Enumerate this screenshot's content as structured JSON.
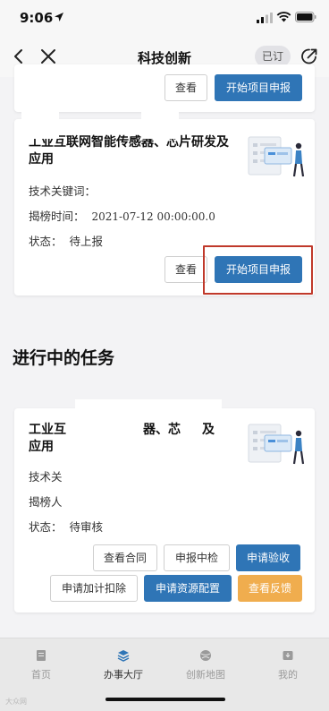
{
  "status_bar": {
    "time": "9:06"
  },
  "nav": {
    "title": "科技创新",
    "subscribe_label": "已订"
  },
  "top_card": {
    "view_label": "查看",
    "apply_label": "开始项目申报"
  },
  "card1": {
    "title": "工业互联网智能传感器、芯片研发及应用",
    "keywords_label": "技术关键词：",
    "time_label": "揭榜时间：",
    "time_value": "2021-07-12 00:00:00.0",
    "status_label": "状态：",
    "status_value": "待上报",
    "view_label": "查看",
    "apply_label": "开始项目申报"
  },
  "section": {
    "in_progress_title": "进行中的任务"
  },
  "card2": {
    "title_line1_start": "工业互",
    "title_line1_end": "器、芯",
    "title_line1_tail": "及",
    "title_line2": "应用",
    "keywords_partial": "技术关",
    "time_partial": "揭榜人",
    "status_label": "状态：",
    "status_value": "待审核",
    "buttons": {
      "view_contract": "查看合同",
      "inspection": "申报中检",
      "acceptance": "申请验收",
      "deduction": "申请加计扣除",
      "resource": "申请资源配置",
      "feedback": "查看反馈"
    }
  },
  "tabs": [
    {
      "label": "首页",
      "icon": "doc-icon"
    },
    {
      "label": "办事大厅",
      "icon": "layers-icon"
    },
    {
      "label": "创新地图",
      "icon": "globe-icon"
    },
    {
      "label": "我的",
      "icon": "inbox-icon"
    }
  ],
  "watermark": "大众网",
  "colors": {
    "primary": "#2f75b6",
    "warning": "#f0ad4e",
    "highlight_border": "#c0392b"
  }
}
